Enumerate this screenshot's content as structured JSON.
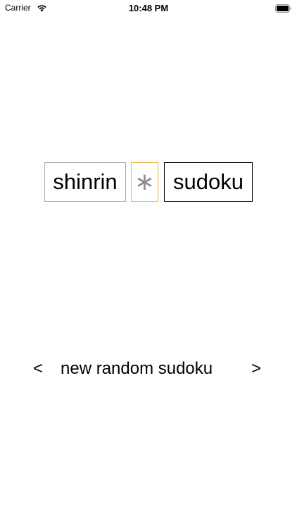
{
  "status_bar": {
    "carrier": "Carrier",
    "time": "10:48 PM",
    "wifi_icon": "wifi-icon",
    "battery_icon": "battery-full-icon"
  },
  "title": {
    "word1": "shinrin",
    "separator": "∗",
    "word2": "sudoku",
    "colors": {
      "word1_border": "#a8a8a8",
      "separator_border": "#f0b44a",
      "separator_text": "#8e8e93",
      "word2_border": "#000000"
    }
  },
  "navigation": {
    "prev": "<",
    "label": "new random sudoku",
    "next": ">"
  }
}
